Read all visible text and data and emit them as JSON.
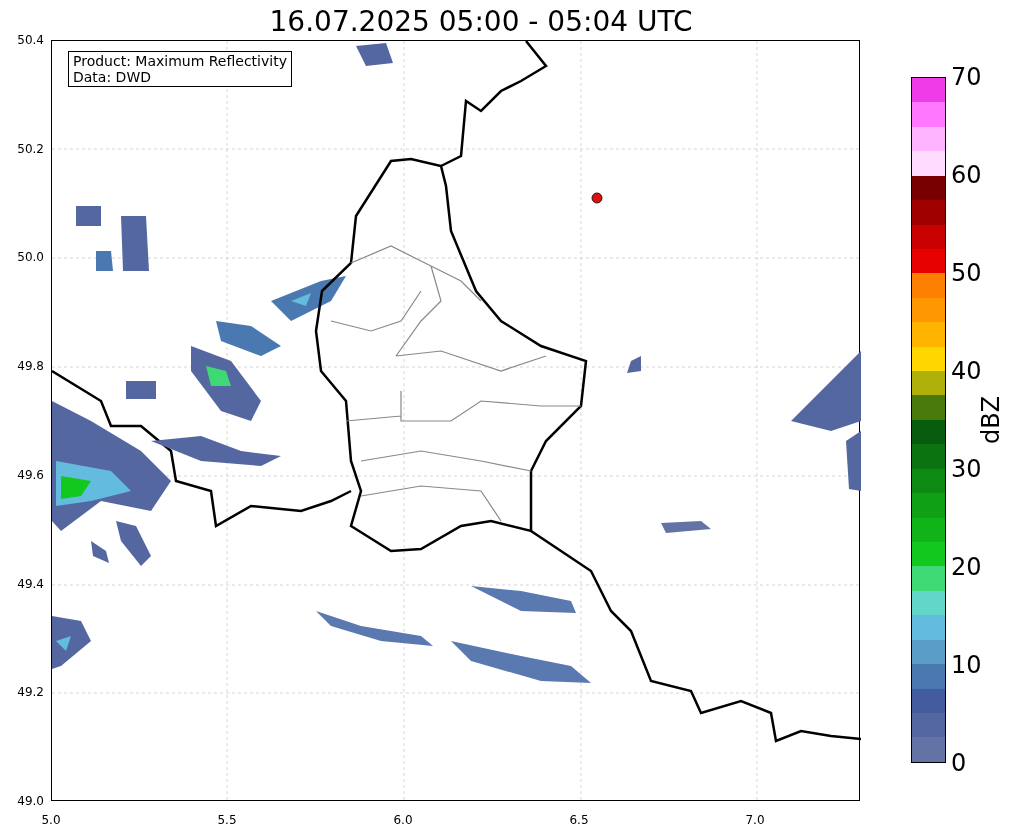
{
  "title": "16.07.2025 05:00 - 05:04 UTC",
  "info_box": {
    "lines": [
      "Product: Maximum Reflectivity",
      "Data: DWD"
    ]
  },
  "y_axis": {
    "ticks": [
      "50.4",
      "50.2",
      "50.0",
      "49.8",
      "49.6",
      "49.4",
      "49.2",
      "49.0"
    ]
  },
  "x_axis": {
    "ticks": [
      "5.0",
      "5.5",
      "6.0",
      "6.5",
      "7.0"
    ]
  },
  "colorbar": {
    "label": "dBZ",
    "ticks": [
      "70",
      "60",
      "50",
      "40",
      "30",
      "20",
      "10",
      "0"
    ],
    "bins": [
      {
        "color": "#6373a6"
      },
      {
        "color": "#5567a0"
      },
      {
        "color": "#445c9e"
      },
      {
        "color": "#4a78b0"
      },
      {
        "color": "#5a9ec8"
      },
      {
        "color": "#63bbdd"
      },
      {
        "color": "#62d6c8"
      },
      {
        "color": "#3ed874"
      },
      {
        "color": "#12c81e"
      },
      {
        "color": "#10b418"
      },
      {
        "color": "#0fa016"
      },
      {
        "color": "#0c8a12"
      },
      {
        "color": "#0b7410"
      },
      {
        "color": "#075c0d"
      },
      {
        "color": "#4a7a0a"
      },
      {
        "color": "#b0b00a"
      },
      {
        "color": "#ffd700"
      },
      {
        "color": "#ffb400"
      },
      {
        "color": "#ff9800"
      },
      {
        "color": "#ff7f00"
      },
      {
        "color": "#e60000"
      },
      {
        "color": "#c80000"
      },
      {
        "color": "#a00000"
      },
      {
        "color": "#780000"
      },
      {
        "color": "#ffdcff"
      },
      {
        "color": "#ffb4ff"
      },
      {
        "color": "#ff78ff"
      },
      {
        "color": "#f03ce8"
      }
    ]
  }
}
